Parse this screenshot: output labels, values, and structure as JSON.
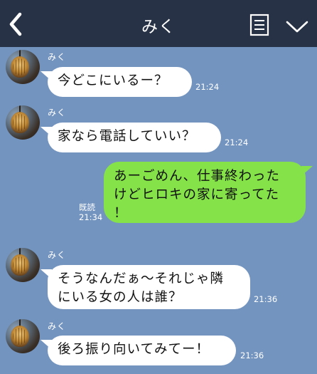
{
  "header": {
    "title": "みく",
    "back_icon": "chevron-left-icon",
    "notes_icon": "notes-icon",
    "menu_icon": "chevron-down-icon",
    "background": "#273246"
  },
  "chat": {
    "background": "#7494c0",
    "incoming_bubble_color": "#ffffff",
    "outgoing_bubble_color": "#85e249",
    "messages": [
      {
        "direction": "incoming",
        "sender": "みく",
        "text": "今どこにいるー？",
        "time": "21:24"
      },
      {
        "direction": "incoming",
        "sender": "みく",
        "text": "家なら電話していい？",
        "time": "21:24"
      },
      {
        "direction": "outgoing",
        "text_lines": [
          "あーごめん、仕事終わった",
          "けどヒロキの家に寄ってた",
          "！"
        ],
        "read": "既読",
        "time": "21:34"
      },
      {
        "direction": "incoming",
        "sender": "みく",
        "text_lines": [
          "そうなんだぁ〜それじゃ隣",
          "にいる女の人は誰？"
        ],
        "time": "21:36"
      },
      {
        "direction": "incoming",
        "sender": "みく",
        "text": "後ろ振り向いてみてー！",
        "time": "21:36"
      }
    ]
  }
}
